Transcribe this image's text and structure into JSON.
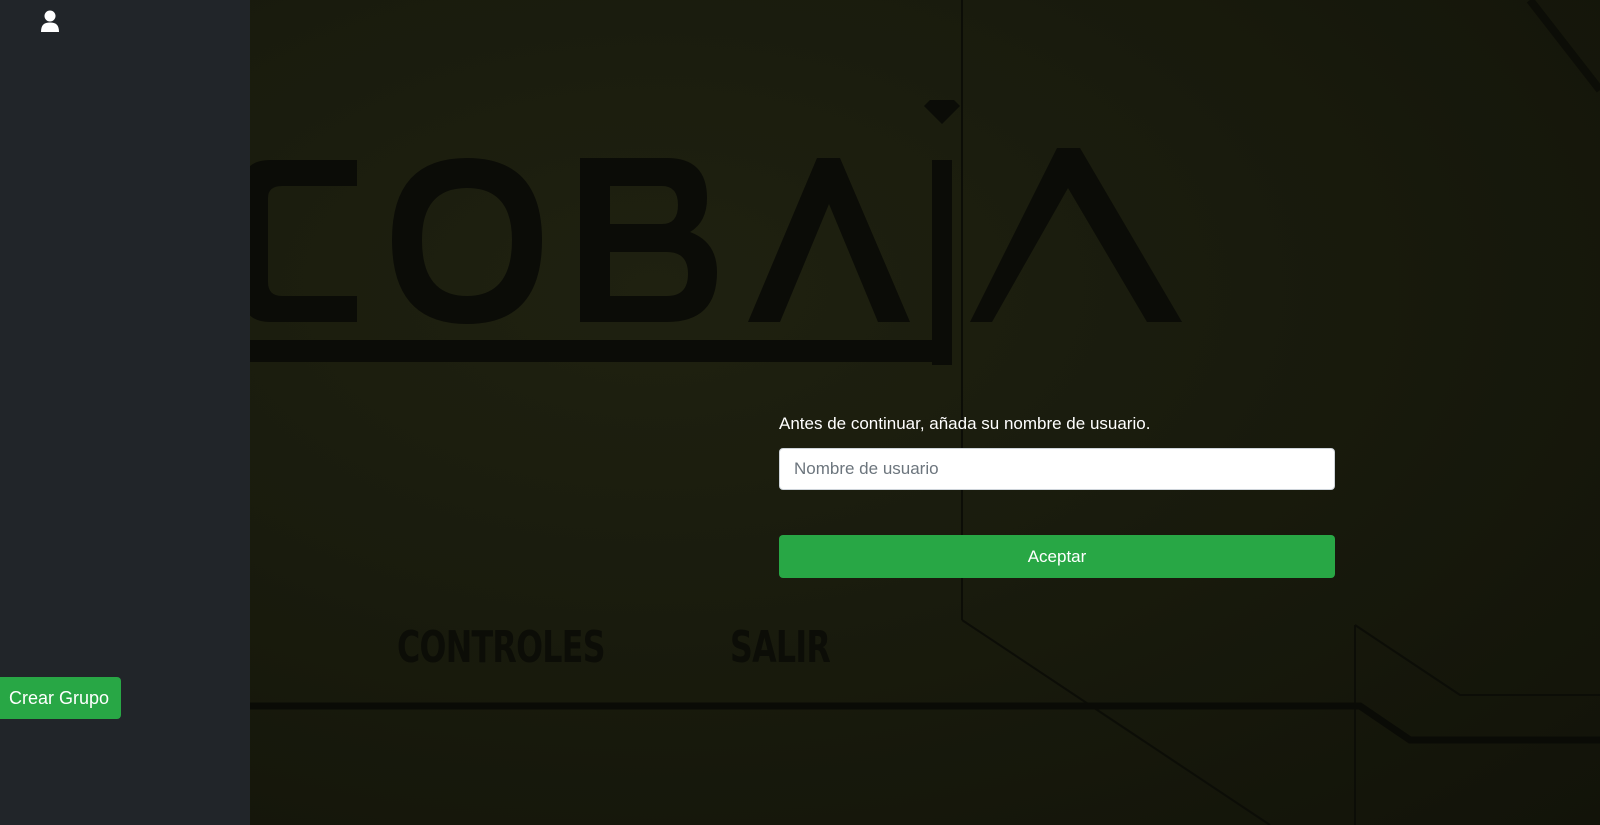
{
  "sidebar": {
    "user_icon": "user-icon",
    "create_group_label": "Crear Grupo"
  },
  "game": {
    "logo_text": "COBAIA",
    "menu": {
      "controls_label": "CONTROLES",
      "exit_label": "SALIR"
    }
  },
  "username_prompt": {
    "label": "Antes de continuar, añada su nombre de usuario.",
    "input_placeholder": "Nombre de usuario",
    "input_value": "",
    "accept_label": "Aceptar"
  },
  "colors": {
    "sidebar_bg": "#212529",
    "accent_green": "#28a745",
    "scene_bg": "#191b0d"
  }
}
